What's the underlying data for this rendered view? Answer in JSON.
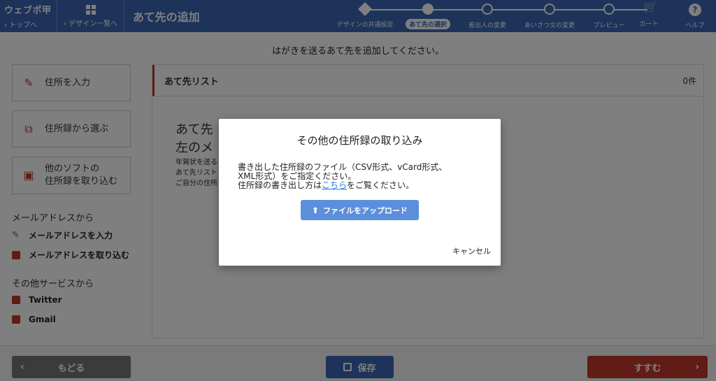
{
  "header": {
    "logo": "ウェブポ甲",
    "back_to_top": "‹ トップへ",
    "design_list": "‹ デザイン一覧へ",
    "page_title": "あて先の追加",
    "steps": [
      {
        "label": "デザインの共通設定"
      },
      {
        "label": "あて先の選択"
      },
      {
        "label": "差出人の変更"
      },
      {
        "label": "あいさつ文の変更"
      },
      {
        "label": "プレビュー"
      },
      {
        "label": "カート"
      }
    ],
    "help": "ヘルプ"
  },
  "main": {
    "instruction": "はがきを送るあて先を追加してください。",
    "buttons": {
      "enter_address": "住所を入力",
      "choose_from_book": "住所録から選ぶ",
      "import_other_line1": "他のソフトの",
      "import_other_line2": "住所録を取り込む"
    },
    "email_section": {
      "title": "メールアドレスから",
      "enter": "メールアドレスを入力",
      "import": "メールアドレスを取り込む"
    },
    "other_section": {
      "title": "その他サービスから",
      "twitter": "Twitter",
      "gmail": "Gmail"
    },
    "list": {
      "title": "あて先リスト",
      "count": "0件",
      "empty_big_1": "あて先",
      "empty_big_2": "左のメ",
      "empty_small_1": "年賀状を送る",
      "empty_small_2": "あて先リスト",
      "empty_small_3": "ご自分の住所"
    }
  },
  "footer": {
    "back": "もどる",
    "save": "保存",
    "next": "すすむ"
  },
  "modal": {
    "title": "その他の住所録の取り込み",
    "text_line1": "書き出した住所録のファイル（CSV形式、vCard形式、",
    "text_line2": "XML形式）をご指定ください。",
    "text_line3_pre": "住所録の書き出し方は",
    "text_link": "こちら",
    "text_line3_post": "をご覧ください。",
    "upload": "ファイルをアップロード",
    "cancel": "キャンセル"
  },
  "colors": {
    "header_blue": "#3a66b5",
    "accent_red": "#c0392b",
    "upload_blue": "#5b8fdc",
    "link_blue": "#2a7bd6"
  },
  "icons": {
    "stepper_current": "dog-icon",
    "cart": "cart-icon",
    "help": "question-icon",
    "enter_address": "pencil-icon",
    "choose_from_book": "copy-icon",
    "import_other": "import-box-icon",
    "upload": "upload-icon",
    "save": "floppy-icon"
  }
}
